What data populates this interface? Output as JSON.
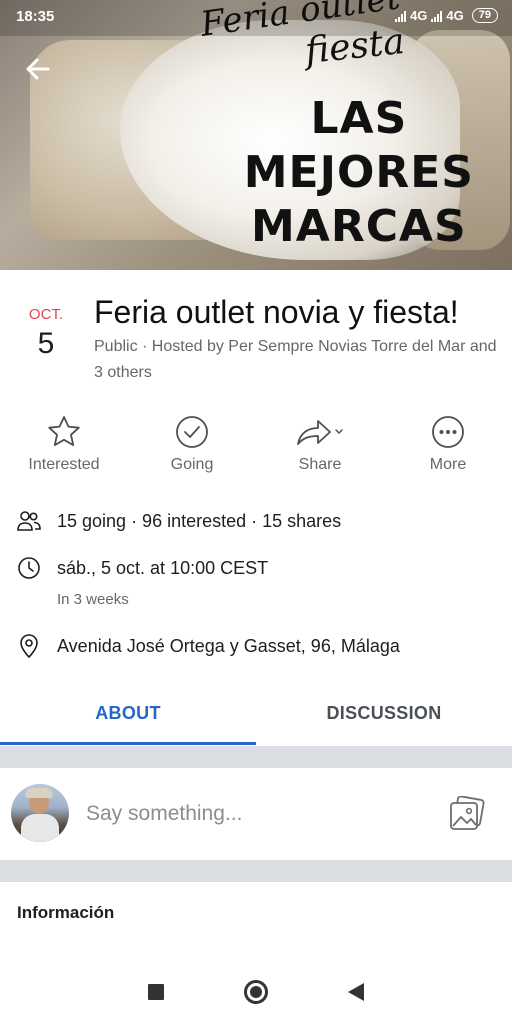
{
  "status_bar": {
    "time": "18:35",
    "network1": "4G",
    "network2": "4G",
    "battery": "79"
  },
  "cover": {
    "script_line1": "Feria outlet",
    "script_line2": "fiesta",
    "headline": [
      "LAS",
      "MEJORES",
      "MARCAS"
    ]
  },
  "event": {
    "month": "OCT.",
    "day": "5",
    "title": "Feria outlet novia y fiesta!",
    "subtitle": "Public · Hosted by Per Sempre Novias Torre del Mar and 3 others"
  },
  "actions": [
    {
      "label": "Interested",
      "icon": "star-icon"
    },
    {
      "label": "Going",
      "icon": "check-circle-icon"
    },
    {
      "label": "Share",
      "icon": "share-icon"
    },
    {
      "label": "More",
      "icon": "more-icon"
    }
  ],
  "details": {
    "stats": "15 going · 96 interested · 15 shares",
    "datetime": "sáb., 5 oct. at 10:00 CEST",
    "relative": "In 3 weeks",
    "location": "Avenida José Ortega y Gasset, 96, Málaga"
  },
  "tabs": {
    "about": "ABOUT",
    "discussion": "DISCUSSION",
    "active": "about"
  },
  "composer": {
    "placeholder": "Say something..."
  },
  "info": {
    "title": "Información"
  },
  "colors": {
    "accent": "#2467c9",
    "date_month": "#e0474a",
    "muted": "#65676b",
    "separator": "#dadde1"
  }
}
